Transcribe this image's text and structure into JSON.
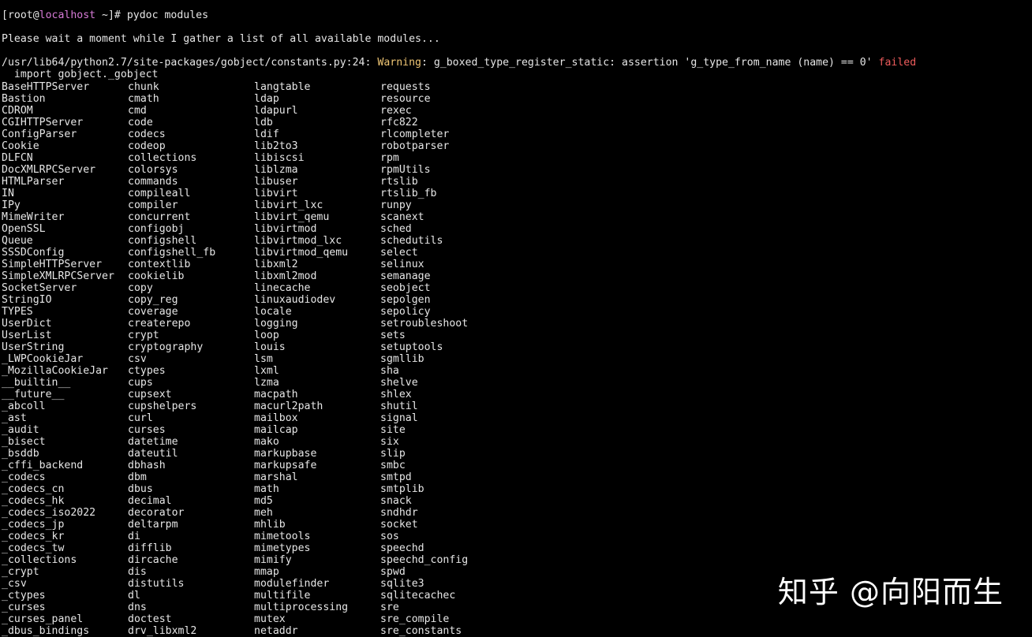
{
  "prompt": {
    "prefix": "[root@",
    "host": "localhost",
    "suffix": " ~]# ",
    "command": "pydoc modules"
  },
  "wait_message": "Please wait a moment while I gather a list of all available modules...",
  "warning": {
    "path": "/usr/lib64/python2.7/site-packages/gobject/constants.py:24: ",
    "label": "Warning",
    "text": ": g_boxed_type_register_static: assertion 'g_type_from_name (name) == 0' ",
    "failed": "failed",
    "continuation": "  import gobject._gobject"
  },
  "columns": [
    [
      "BaseHTTPServer",
      "Bastion",
      "CDROM",
      "CGIHTTPServer",
      "ConfigParser",
      "Cookie",
      "DLFCN",
      "DocXMLRPCServer",
      "HTMLParser",
      "IN",
      "IPy",
      "MimeWriter",
      "OpenSSL",
      "Queue",
      "SSSDConfig",
      "SimpleHTTPServer",
      "SimpleXMLRPCServer",
      "SocketServer",
      "StringIO",
      "TYPES",
      "UserDict",
      "UserList",
      "UserString",
      "_LWPCookieJar",
      "_MozillaCookieJar",
      "__builtin__",
      "__future__",
      "_abcoll",
      "_ast",
      "_audit",
      "_bisect",
      "_bsddb",
      "_cffi_backend",
      "_codecs",
      "_codecs_cn",
      "_codecs_hk",
      "_codecs_iso2022",
      "_codecs_jp",
      "_codecs_kr",
      "_codecs_tw",
      "_collections",
      "_crypt",
      "_csv",
      "_ctypes",
      "_curses",
      "_curses_panel",
      "_dbus_bindings"
    ],
    [
      "chunk",
      "cmath",
      "cmd",
      "code",
      "codecs",
      "codeop",
      "collections",
      "colorsys",
      "commands",
      "compileall",
      "compiler",
      "concurrent",
      "configobj",
      "configshell",
      "configshell_fb",
      "contextlib",
      "cookielib",
      "copy",
      "copy_reg",
      "coverage",
      "createrepo",
      "crypt",
      "cryptography",
      "csv",
      "ctypes",
      "cups",
      "cupsext",
      "cupshelpers",
      "curl",
      "curses",
      "datetime",
      "dateutil",
      "dbhash",
      "dbm",
      "dbus",
      "decimal",
      "decorator",
      "deltarpm",
      "di",
      "difflib",
      "dircache",
      "dis",
      "distutils",
      "dl",
      "dns",
      "doctest",
      "drv_libxml2"
    ],
    [
      "langtable",
      "ldap",
      "ldapurl",
      "ldb",
      "ldif",
      "lib2to3",
      "libiscsi",
      "liblzma",
      "libuser",
      "libvirt",
      "libvirt_lxc",
      "libvirt_qemu",
      "libvirtmod",
      "libvirtmod_lxc",
      "libvirtmod_qemu",
      "libxml2",
      "libxml2mod",
      "linecache",
      "linuxaudiodev",
      "locale",
      "logging",
      "loop",
      "louis",
      "lsm",
      "lxml",
      "lzma",
      "macpath",
      "macurl2path",
      "mailbox",
      "mailcap",
      "mako",
      "markupbase",
      "markupsafe",
      "marshal",
      "math",
      "md5",
      "meh",
      "mhlib",
      "mimetools",
      "mimetypes",
      "mimify",
      "mmap",
      "modulefinder",
      "multifile",
      "multiprocessing",
      "mutex",
      "netaddr"
    ],
    [
      "requests",
      "resource",
      "rexec",
      "rfc822",
      "rlcompleter",
      "robotparser",
      "rpm",
      "rpmUtils",
      "rtslib",
      "rtslib_fb",
      "runpy",
      "scanext",
      "sched",
      "schedutils",
      "select",
      "selinux",
      "semanage",
      "seobject",
      "sepolgen",
      "sepolicy",
      "setroubleshoot",
      "sets",
      "setuptools",
      "sgmllib",
      "sha",
      "shelve",
      "shlex",
      "shutil",
      "signal",
      "site",
      "six",
      "slip",
      "smbc",
      "smtpd",
      "smtplib",
      "snack",
      "sndhdr",
      "socket",
      "sos",
      "speechd",
      "speechd_config",
      "spwd",
      "sqlite3",
      "sqlitecachec",
      "sre",
      "sre_compile",
      "sre_constants"
    ]
  ],
  "watermark": "知乎 @向阳而生",
  "colors": {
    "background": "#000000",
    "foreground": "#e6e6e6",
    "hostname": "#d77bd7",
    "warning": "#f0c674",
    "failed": "#ee5c5c"
  }
}
